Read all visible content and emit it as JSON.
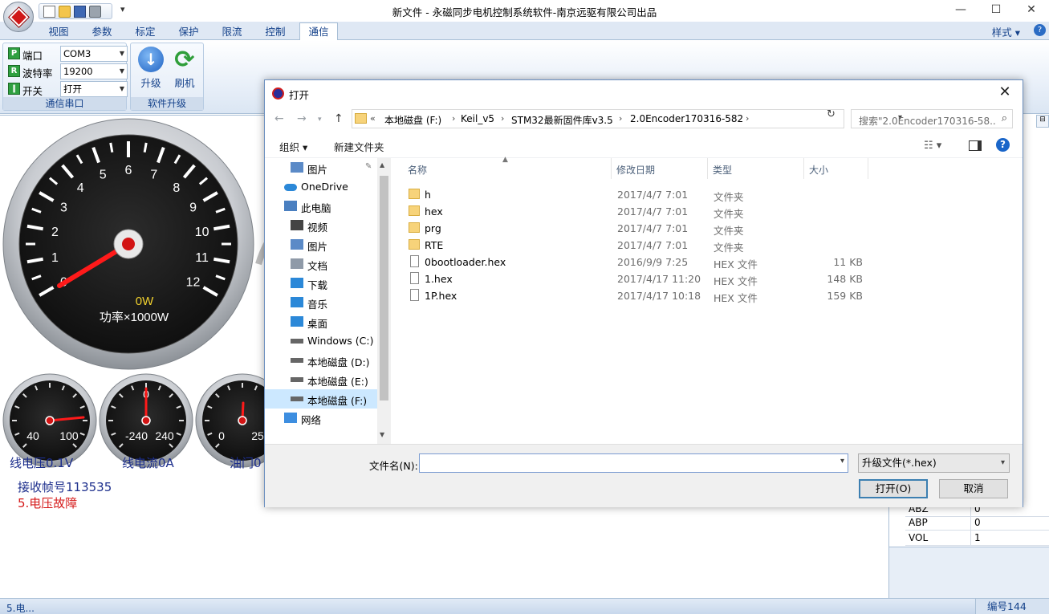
{
  "app": {
    "title": "新文件 - 永磁同步电机控制系统软件-南京远驱有限公司出品",
    "window_controls": {
      "minimize": "—",
      "maximize": "☐",
      "close": "✕"
    }
  },
  "ribbon": {
    "tabs": [
      "视图",
      "参数",
      "标定",
      "保护",
      "限流",
      "控制",
      "通信"
    ],
    "active_tab": "通信",
    "style_menu": "样式",
    "comm_group": {
      "label": "通信串口",
      "rows": [
        {
          "icon_letter": "P",
          "label": "端口",
          "value": "COM3"
        },
        {
          "icon_letter": "R",
          "label": "波特率",
          "value": "19200"
        },
        {
          "icon_letter": "‖",
          "label": "开关",
          "value": "打开"
        }
      ]
    },
    "upgrade_group": {
      "label": "软件升级",
      "buttons": [
        {
          "label": "升级",
          "icon": "download-arrow-icon"
        },
        {
          "label": "刷机",
          "icon": "refresh-icon"
        }
      ]
    }
  },
  "gauges": {
    "main": {
      "ticks": [
        "0",
        "1",
        "2",
        "3",
        "4",
        "5",
        "6",
        "7",
        "8",
        "9",
        "10",
        "11",
        "12"
      ],
      "value_text": "0W",
      "unit_text": "功率×1000W",
      "value_color": "#f2d22e"
    },
    "small": [
      {
        "ticks": [
          "40",
          "100"
        ],
        "caption": "线电压0.1V"
      },
      {
        "ticks": [
          "-240",
          "0",
          "240"
        ],
        "caption": "线电流0A"
      },
      {
        "ticks": [
          "0",
          "25"
        ],
        "caption": "油门0"
      }
    ]
  },
  "status_texts": {
    "frame": "接收帧号113535",
    "fault": "5.电压故障"
  },
  "properties": {
    "rows": [
      {
        "key": "ABZ",
        "value": "0"
      },
      {
        "key": "ABP",
        "value": "0"
      },
      {
        "key": "VOL",
        "value": "1"
      }
    ]
  },
  "statusbar": {
    "left": "5.电...",
    "right": "编号144"
  },
  "dialog": {
    "title": "打开",
    "breadcrumbs": [
      "本地磁盘 (F:)",
      "Keil_v5",
      "STM32最新固件库v3.5",
      "2.0Encoder170316-582"
    ],
    "search_placeholder": "搜索\"2.0Encoder170316-58...",
    "commands": {
      "organize": "组织 ▾",
      "new_folder": "新建文件夹"
    },
    "nav_items": [
      {
        "label": "图片",
        "icon": "pictures-icon",
        "indent": 1,
        "pinned": true
      },
      {
        "label": "OneDrive",
        "icon": "cloud-icon",
        "indent": 0
      },
      {
        "label": "此电脑",
        "icon": "computer-icon",
        "indent": 0
      },
      {
        "label": "视频",
        "icon": "video-icon",
        "indent": 1
      },
      {
        "label": "图片",
        "icon": "pictures-icon",
        "indent": 1
      },
      {
        "label": "文档",
        "icon": "documents-icon",
        "indent": 1
      },
      {
        "label": "下载",
        "icon": "download-icon",
        "indent": 1
      },
      {
        "label": "音乐",
        "icon": "music-icon",
        "indent": 1
      },
      {
        "label": "桌面",
        "icon": "desktop-icon",
        "indent": 1
      },
      {
        "label": "Windows (C:)",
        "icon": "drive-icon",
        "indent": 1
      },
      {
        "label": "本地磁盘 (D:)",
        "icon": "drive-icon",
        "indent": 1
      },
      {
        "label": "本地磁盘 (E:)",
        "icon": "drive-icon",
        "indent": 1
      },
      {
        "label": "本地磁盘 (F:)",
        "icon": "drive-icon",
        "indent": 1,
        "selected": true
      },
      {
        "label": "网络",
        "icon": "network-icon",
        "indent": 0
      }
    ],
    "columns": [
      "名称",
      "修改日期",
      "类型",
      "大小"
    ],
    "files": [
      {
        "name": "h",
        "date": "2017/4/7 7:01",
        "type": "文件夹",
        "size": "",
        "kind": "folder"
      },
      {
        "name": "hex",
        "date": "2017/4/7 7:01",
        "type": "文件夹",
        "size": "",
        "kind": "folder"
      },
      {
        "name": "prg",
        "date": "2017/4/7 7:01",
        "type": "文件夹",
        "size": "",
        "kind": "folder"
      },
      {
        "name": "RTE",
        "date": "2017/4/7 7:01",
        "type": "文件夹",
        "size": "",
        "kind": "folder"
      },
      {
        "name": "0bootloader.hex",
        "date": "2016/9/9 7:25",
        "type": "HEX 文件",
        "size": "11 KB",
        "kind": "file"
      },
      {
        "name": "1.hex",
        "date": "2017/4/17 11:20",
        "type": "HEX 文件",
        "size": "148 KB",
        "kind": "file"
      },
      {
        "name": "1P.hex",
        "date": "2017/4/17 10:18",
        "type": "HEX 文件",
        "size": "159 KB",
        "kind": "file"
      }
    ],
    "filename_label": "文件名(N):",
    "filename_value": "",
    "filetype": "升级文件(*.hex)",
    "open_button": "打开(O)",
    "cancel_button": "取消"
  }
}
